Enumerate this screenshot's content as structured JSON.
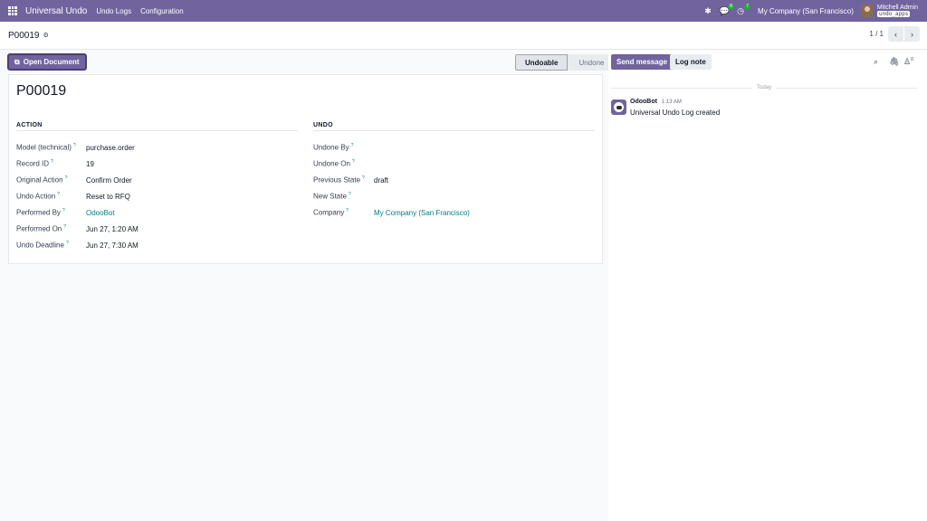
{
  "topbar": {
    "app_title": "Universal Undo",
    "menu": [
      "Undo Logs",
      "Configuration"
    ],
    "messages_count": "8",
    "activities_count": "7",
    "company": "My Company (San Francisco)",
    "user_name": "Mitchell Admin",
    "database": "undo_apps",
    "bar_color": "#71639e"
  },
  "control": {
    "breadcrumb": "P00019",
    "pager_value": "1 / 1"
  },
  "header": {
    "open_document": "Open Document",
    "stages": [
      "Undoable",
      "Undone"
    ],
    "current_stage": "Undoable"
  },
  "form": {
    "title": "P00019",
    "action_group": {
      "title": "ACTION",
      "fields": [
        {
          "label": "Model (technical)",
          "value": "purchase.order",
          "link": false
        },
        {
          "label": "Record ID",
          "value": "19",
          "link": false
        },
        {
          "label": "Original Action",
          "value": "Confirm Order",
          "link": false
        },
        {
          "label": "Undo Action",
          "value": "Reset to RFQ",
          "link": false
        },
        {
          "label": "Performed By",
          "value": "OdooBot",
          "link": true
        },
        {
          "label": "Performed On",
          "value": "Jun 27, 1:20 AM",
          "link": false
        },
        {
          "label": "Undo Deadline",
          "value": "Jun 27, 7:30 AM",
          "link": false
        }
      ]
    },
    "undo_group": {
      "title": "UNDO",
      "fields": [
        {
          "label": "Undone By",
          "value": "",
          "link": false
        },
        {
          "label": "Undone On",
          "value": "",
          "link": false
        },
        {
          "label": "Previous State",
          "value": "draft",
          "link": false
        },
        {
          "label": "New State",
          "value": "",
          "link": false
        },
        {
          "label": "Company",
          "value": "My Company (San Francisco)",
          "link": true
        }
      ]
    },
    "help_mark": "?"
  },
  "chatter": {
    "send_message": "Send message",
    "log_note": "Log note",
    "followers_count": "0",
    "date_separator": "Today",
    "messages": [
      {
        "author": "OdooBot",
        "time": "1:13 AM",
        "body": "Universal Undo Log created"
      }
    ]
  }
}
